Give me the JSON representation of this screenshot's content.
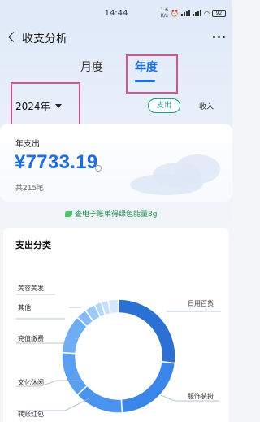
{
  "status_bar": {
    "time": "14:44",
    "net_speed_value": "1.6",
    "net_speed_unit": "K/s",
    "battery": "92"
  },
  "nav": {
    "title": "收支分析"
  },
  "tabs": [
    {
      "label": "月度",
      "active": false
    },
    {
      "label": "年度",
      "active": true
    }
  ],
  "filter": {
    "year": "2024年",
    "type_options": [
      {
        "label": "支出",
        "selected": true
      },
      {
        "label": "收入",
        "selected": false
      }
    ]
  },
  "summary": {
    "label": "年支出",
    "amount": "¥7733.19",
    "count": "共215笔"
  },
  "banner": {
    "text": "查电子账单得绿色能量8g"
  },
  "categories": {
    "title": "支出分类",
    "labels": [
      "美容美发",
      "其他",
      "充值缴费",
      "文化休闲",
      "转账红包",
      "日用百货",
      "服饰装扮"
    ]
  },
  "chart_data": {
    "type": "pie",
    "title": "支出分类",
    "slices": [
      {
        "name": "日用百货",
        "value": 27,
        "color": "#2b70d2"
      },
      {
        "name": "服饰装扮",
        "value": 22,
        "color": "#3a86e8"
      },
      {
        "name": "转账红包",
        "value": 14,
        "color": "#4a93ee"
      },
      {
        "name": "文化休闲",
        "value": 13,
        "color": "#5b9ff2"
      },
      {
        "name": "充值缴费",
        "value": 11,
        "color": "#6fadf4"
      },
      {
        "name": "其他",
        "value": 3,
        "color": "#85bcf6"
      },
      {
        "name": "美容美发",
        "value": 3,
        "color": "#9ac9f8"
      },
      {
        "name": "",
        "value": 2,
        "color": "#b0d6fa"
      },
      {
        "name": "",
        "value": 2,
        "color": "#c3e0fb"
      },
      {
        "name": "",
        "value": 3,
        "color": "#d3e8fc"
      }
    ]
  }
}
